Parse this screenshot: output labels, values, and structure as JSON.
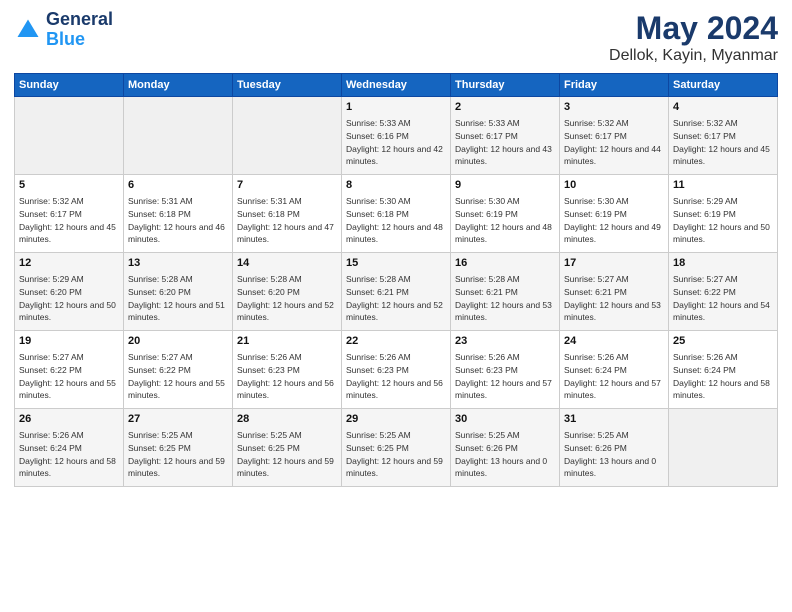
{
  "header": {
    "logo_blue": "Blue",
    "title": "May 2024",
    "subtitle": "Dellok, Kayin, Myanmar"
  },
  "days": [
    "Sunday",
    "Monday",
    "Tuesday",
    "Wednesday",
    "Thursday",
    "Friday",
    "Saturday"
  ],
  "weeks": [
    [
      {
        "date": "",
        "sunrise": "",
        "sunset": "",
        "daylight": ""
      },
      {
        "date": "",
        "sunrise": "",
        "sunset": "",
        "daylight": ""
      },
      {
        "date": "",
        "sunrise": "",
        "sunset": "",
        "daylight": ""
      },
      {
        "date": "1",
        "sunrise": "Sunrise: 5:33 AM",
        "sunset": "Sunset: 6:16 PM",
        "daylight": "Daylight: 12 hours and 42 minutes."
      },
      {
        "date": "2",
        "sunrise": "Sunrise: 5:33 AM",
        "sunset": "Sunset: 6:17 PM",
        "daylight": "Daylight: 12 hours and 43 minutes."
      },
      {
        "date": "3",
        "sunrise": "Sunrise: 5:32 AM",
        "sunset": "Sunset: 6:17 PM",
        "daylight": "Daylight: 12 hours and 44 minutes."
      },
      {
        "date": "4",
        "sunrise": "Sunrise: 5:32 AM",
        "sunset": "Sunset: 6:17 PM",
        "daylight": "Daylight: 12 hours and 45 minutes."
      }
    ],
    [
      {
        "date": "5",
        "sunrise": "Sunrise: 5:32 AM",
        "sunset": "Sunset: 6:17 PM",
        "daylight": "Daylight: 12 hours and 45 minutes."
      },
      {
        "date": "6",
        "sunrise": "Sunrise: 5:31 AM",
        "sunset": "Sunset: 6:18 PM",
        "daylight": "Daylight: 12 hours and 46 minutes."
      },
      {
        "date": "7",
        "sunrise": "Sunrise: 5:31 AM",
        "sunset": "Sunset: 6:18 PM",
        "daylight": "Daylight: 12 hours and 47 minutes."
      },
      {
        "date": "8",
        "sunrise": "Sunrise: 5:30 AM",
        "sunset": "Sunset: 6:18 PM",
        "daylight": "Daylight: 12 hours and 48 minutes."
      },
      {
        "date": "9",
        "sunrise": "Sunrise: 5:30 AM",
        "sunset": "Sunset: 6:19 PM",
        "daylight": "Daylight: 12 hours and 48 minutes."
      },
      {
        "date": "10",
        "sunrise": "Sunrise: 5:30 AM",
        "sunset": "Sunset: 6:19 PM",
        "daylight": "Daylight: 12 hours and 49 minutes."
      },
      {
        "date": "11",
        "sunrise": "Sunrise: 5:29 AM",
        "sunset": "Sunset: 6:19 PM",
        "daylight": "Daylight: 12 hours and 50 minutes."
      }
    ],
    [
      {
        "date": "12",
        "sunrise": "Sunrise: 5:29 AM",
        "sunset": "Sunset: 6:20 PM",
        "daylight": "Daylight: 12 hours and 50 minutes."
      },
      {
        "date": "13",
        "sunrise": "Sunrise: 5:28 AM",
        "sunset": "Sunset: 6:20 PM",
        "daylight": "Daylight: 12 hours and 51 minutes."
      },
      {
        "date": "14",
        "sunrise": "Sunrise: 5:28 AM",
        "sunset": "Sunset: 6:20 PM",
        "daylight": "Daylight: 12 hours and 52 minutes."
      },
      {
        "date": "15",
        "sunrise": "Sunrise: 5:28 AM",
        "sunset": "Sunset: 6:21 PM",
        "daylight": "Daylight: 12 hours and 52 minutes."
      },
      {
        "date": "16",
        "sunrise": "Sunrise: 5:28 AM",
        "sunset": "Sunset: 6:21 PM",
        "daylight": "Daylight: 12 hours and 53 minutes."
      },
      {
        "date": "17",
        "sunrise": "Sunrise: 5:27 AM",
        "sunset": "Sunset: 6:21 PM",
        "daylight": "Daylight: 12 hours and 53 minutes."
      },
      {
        "date": "18",
        "sunrise": "Sunrise: 5:27 AM",
        "sunset": "Sunset: 6:22 PM",
        "daylight": "Daylight: 12 hours and 54 minutes."
      }
    ],
    [
      {
        "date": "19",
        "sunrise": "Sunrise: 5:27 AM",
        "sunset": "Sunset: 6:22 PM",
        "daylight": "Daylight: 12 hours and 55 minutes."
      },
      {
        "date": "20",
        "sunrise": "Sunrise: 5:27 AM",
        "sunset": "Sunset: 6:22 PM",
        "daylight": "Daylight: 12 hours and 55 minutes."
      },
      {
        "date": "21",
        "sunrise": "Sunrise: 5:26 AM",
        "sunset": "Sunset: 6:23 PM",
        "daylight": "Daylight: 12 hours and 56 minutes."
      },
      {
        "date": "22",
        "sunrise": "Sunrise: 5:26 AM",
        "sunset": "Sunset: 6:23 PM",
        "daylight": "Daylight: 12 hours and 56 minutes."
      },
      {
        "date": "23",
        "sunrise": "Sunrise: 5:26 AM",
        "sunset": "Sunset: 6:23 PM",
        "daylight": "Daylight: 12 hours and 57 minutes."
      },
      {
        "date": "24",
        "sunrise": "Sunrise: 5:26 AM",
        "sunset": "Sunset: 6:24 PM",
        "daylight": "Daylight: 12 hours and 57 minutes."
      },
      {
        "date": "25",
        "sunrise": "Sunrise: 5:26 AM",
        "sunset": "Sunset: 6:24 PM",
        "daylight": "Daylight: 12 hours and 58 minutes."
      }
    ],
    [
      {
        "date": "26",
        "sunrise": "Sunrise: 5:26 AM",
        "sunset": "Sunset: 6:24 PM",
        "daylight": "Daylight: 12 hours and 58 minutes."
      },
      {
        "date": "27",
        "sunrise": "Sunrise: 5:25 AM",
        "sunset": "Sunset: 6:25 PM",
        "daylight": "Daylight: 12 hours and 59 minutes."
      },
      {
        "date": "28",
        "sunrise": "Sunrise: 5:25 AM",
        "sunset": "Sunset: 6:25 PM",
        "daylight": "Daylight: 12 hours and 59 minutes."
      },
      {
        "date": "29",
        "sunrise": "Sunrise: 5:25 AM",
        "sunset": "Sunset: 6:25 PM",
        "daylight": "Daylight: 12 hours and 59 minutes."
      },
      {
        "date": "30",
        "sunrise": "Sunrise: 5:25 AM",
        "sunset": "Sunset: 6:26 PM",
        "daylight": "Daylight: 13 hours and 0 minutes."
      },
      {
        "date": "31",
        "sunrise": "Sunrise: 5:25 AM",
        "sunset": "Sunset: 6:26 PM",
        "daylight": "Daylight: 13 hours and 0 minutes."
      },
      {
        "date": "",
        "sunrise": "",
        "sunset": "",
        "daylight": ""
      }
    ]
  ]
}
